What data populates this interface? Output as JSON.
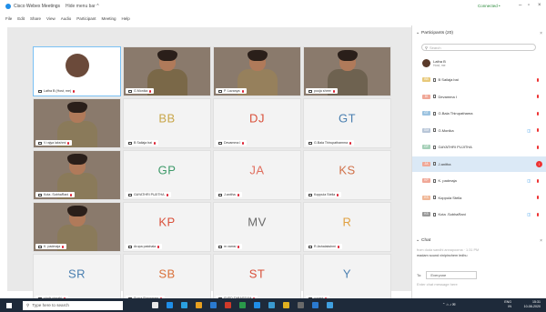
{
  "window": {
    "title": "Cisco Webex Meetings",
    "hide_menu": "Hide menu bar ^",
    "status": "Connected •",
    "controls": [
      "–",
      "▫",
      "×"
    ]
  },
  "menu": [
    "File",
    "Edit",
    "Share",
    "View",
    "Audio",
    "Participant",
    "Meeting",
    "Help"
  ],
  "tiles": [
    {
      "name": "Latha B (Host, me)",
      "initials": "",
      "type": "avatar",
      "active": true
    },
    {
      "name": "G.Monika",
      "initials": "",
      "type": "video"
    },
    {
      "name": "P. Lavanya",
      "initials": "",
      "type": "video"
    },
    {
      "name": "pooja shree",
      "initials": "",
      "type": "video"
    },
    {
      "name": "V rajya lakshmi",
      "initials": "",
      "type": "video"
    },
    {
      "name": "B Sailaja bai",
      "initials": "BB",
      "type": "initials",
      "color": "#c8a64a"
    },
    {
      "name": "Devamma I",
      "initials": "DJ",
      "type": "initials",
      "color": "#d9503a"
    },
    {
      "name": "G.Bala Thirupathamma",
      "initials": "GT",
      "type": "initials",
      "color": "#4a7fb0"
    },
    {
      "name": "Kota .SobhaRani",
      "initials": "",
      "type": "video"
    },
    {
      "name": "GAYATHRI PUJITHA",
      "initials": "GP",
      "type": "initials",
      "color": "#3f9a6a"
    },
    {
      "name": "J.anitha",
      "initials": "JA",
      "type": "initials",
      "color": "#e07060"
    },
    {
      "name": "Koppula Stella",
      "initials": "KS",
      "type": "initials",
      "color": "#d07048"
    },
    {
      "name": "K. padmaja",
      "initials": "",
      "type": "video"
    },
    {
      "name": "Arupa patchala",
      "initials": "KP",
      "type": "initials",
      "color": "#d9503a"
    },
    {
      "name": "m vamsi",
      "initials": "MV",
      "type": "initials",
      "color": "#6a6a6a"
    },
    {
      "name": "R.Ashalakshmi",
      "initials": "R",
      "type": "initials",
      "color": "#e0a040"
    },
    {
      "name": "shaik nimabi",
      "initials": "SR",
      "type": "initials",
      "color": "#4a7fb0"
    },
    {
      "name": "Suma Rangaram",
      "initials": "SB",
      "type": "initials",
      "color": "#d9703a"
    },
    {
      "name": "SYED TABASSUM",
      "initials": "ST",
      "type": "initials",
      "color": "#d9503a"
    },
    {
      "name": "y.mani",
      "initials": "Y",
      "type": "initials",
      "color": "#4a7fb0"
    }
  ],
  "participants": {
    "title": "Participants (20)",
    "search_placeholder": "Search",
    "host": {
      "name": "Latha B",
      "role": "Host, me"
    },
    "list": [
      {
        "badge": "BB",
        "name": "B Sailaja bai",
        "color": "#e8c97a"
      },
      {
        "badge": "DI",
        "name": "Devamma I",
        "color": "#f0a898"
      },
      {
        "badge": "GT",
        "name": "G.Bala Thirupathama",
        "color": "#9cc3e0"
      },
      {
        "badge": "GM",
        "name": "G.Monika",
        "color": "#b8c6d8",
        "extra": "◫"
      },
      {
        "badge": "GP",
        "name": "GAYATHRI PUJITHA",
        "color": "#a6d0b8"
      },
      {
        "badge": "JA",
        "name": "J.anitha",
        "color": "#f0a898",
        "selected": true
      },
      {
        "badge": "KP",
        "name": "K. padmaja",
        "color": "#f0a898",
        "extra": "◫"
      },
      {
        "badge": "KS",
        "name": "Koppula Stella",
        "color": "#f0b898"
      },
      {
        "badge": "KS",
        "name": "Kota .SobhaRani",
        "color": "#999999",
        "extra": "◫"
      }
    ]
  },
  "chat": {
    "title": "Chat",
    "sender": "from duda sandhi annapoorna · 1:31 PM",
    "message": "madam sound vinipinchem ledhu",
    "to_label": "To:",
    "to_value": "Everyone",
    "placeholder": "Enter chat message here"
  },
  "taskbar": {
    "search_placeholder": "Type here to search",
    "apps": [
      "#e8e8e8",
      "#1f8ee8",
      "#2aa0e0",
      "#e8a020",
      "#2a7ad0",
      "#d03a2a",
      "#2a9a4a",
      "#1f8ee8",
      "#3a9ad0",
      "#e0b020",
      "#6a6a6a",
      "#2a7ad0",
      "#40a0e0"
    ],
    "lang": "ENG IN",
    "time": "15:31",
    "date": "10-08-2020"
  }
}
